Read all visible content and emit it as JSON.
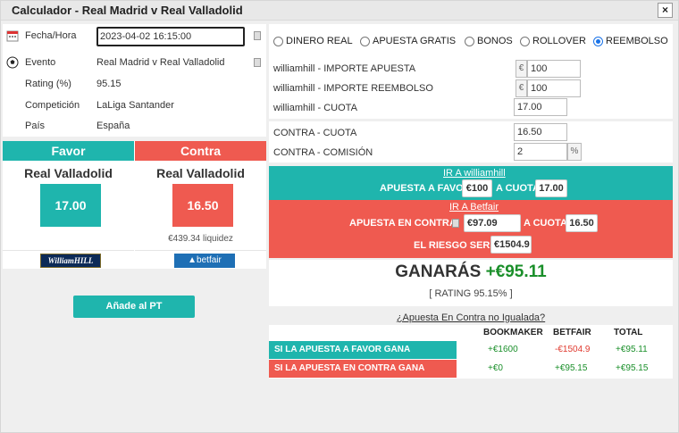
{
  "window": {
    "title": "Calculador - Real Madrid v Real Valladolid",
    "close": "×"
  },
  "info": {
    "fecha_label": "Fecha/Hora",
    "fecha_value": "2023-04-02 16:15:00",
    "evento_label": "Evento",
    "evento_value": "Real Madrid v Real Valladolid",
    "rating_label": "Rating (%)",
    "rating_value": "95.15",
    "competicion_label": "Competición",
    "competicion_value": "LaLiga Santander",
    "pais_label": "País",
    "pais_value": "España"
  },
  "favor": {
    "header": "Favor",
    "team": "Real Valladolid",
    "odds": "17.00",
    "logo": "WilliamHILL"
  },
  "contra": {
    "header": "Contra",
    "team": "Real Valladolid",
    "odds": "16.50",
    "liquidity": "€439.34 liquidez",
    "logo": "betfair"
  },
  "add_button": "Añade al PT",
  "modes": {
    "options": [
      "DINERO REAL",
      "APUESTA GRATIS",
      "BONOS",
      "ROLLOVER",
      "REEMBOLSO"
    ],
    "selected": "REEMBOLSO"
  },
  "bookmaker_fields": {
    "importe_label": "williamhill - IMPORTE APUESTA",
    "importe_currency": "€",
    "importe_value": "100",
    "reembolso_label": "williamhill - IMPORTE REEMBOLSO",
    "reembolso_currency": "€",
    "reembolso_value": "100",
    "cuota_label": "williamhill - CUOTA",
    "cuota_value": "17.00"
  },
  "exchange_fields": {
    "cuota_label": "CONTRA - CUOTA",
    "cuota_value": "16.50",
    "comision_label": "CONTRA - COMISIÓN",
    "comision_value": "2",
    "comision_unit": "%"
  },
  "favor_instruction": {
    "link": "IR A williamhill",
    "text1": "APUESTA A FAVOR",
    "stake": "€100",
    "text2": "A CUOTA",
    "odds": "17.00"
  },
  "contra_instruction": {
    "link": "IR A Betfair",
    "text1": "APUESTA EN CONTRA",
    "stake": "€97.09",
    "text2": "A CUOTA",
    "odds": "16.50",
    "risk_label": "EL RIESGO SERÁ",
    "risk_value": "€1504.9"
  },
  "result": {
    "ganaras_label": "GANARÁS",
    "ganaras_value": "+€95.11",
    "rating_text": "[ RATING 95.15% ]"
  },
  "mismatch_link": "¿Apuesta En Contra no Igualada?",
  "table": {
    "headers": [
      "BOOKMAKER",
      "BETFAIR",
      "TOTAL"
    ],
    "rows": [
      {
        "label": "SI LA APUESTA A FAVOR GANA",
        "bookmaker": "+€1600",
        "betfair": "-€1504.9",
        "total": "+€95.11"
      },
      {
        "label": "SI LA APUESTA EN CONTRA GANA",
        "bookmaker": "+€0",
        "betfair": "+€95.15",
        "total": "+€95.15"
      }
    ]
  },
  "colors": {
    "teal": "#1fb5ad",
    "red": "#ef5a50",
    "green": "#1a8f2a"
  }
}
